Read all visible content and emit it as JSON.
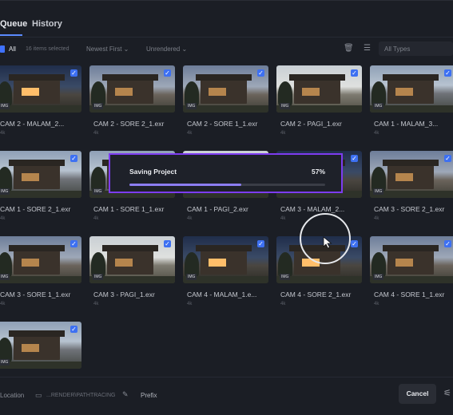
{
  "tabs": {
    "queue": "Queue",
    "history": "History"
  },
  "filter": {
    "all_label": "All",
    "selected_text": "16 items selected",
    "sort_label": "Newest First ⌄",
    "status_label": "Unrendered ⌄",
    "types_label": "All Types"
  },
  "items": [
    {
      "name": "CAM 2 - MALAM_2...",
      "sub": "4k",
      "badge": "IMG",
      "style": "night"
    },
    {
      "name": "CAM 2 - SORE 2_1.exr",
      "sub": "4k",
      "badge": "IMG",
      "style": "evening"
    },
    {
      "name": "CAM 2 - SORE 1_1.exr",
      "sub": "4k",
      "badge": "IMG",
      "style": "evening"
    },
    {
      "name": "CAM 2 - PAGI_1.exr",
      "sub": "4k",
      "badge": "IMG",
      "style": "dawn"
    },
    {
      "name": "CAM 1 - MALAM_3...",
      "sub": "4k",
      "badge": "IMG",
      "style": "day"
    },
    {
      "name": "CAM 1 - SORE 2_1.exr",
      "sub": "4k",
      "badge": "IMG",
      "style": "day"
    },
    {
      "name": "CAM 1 - SORE 1_1.exr",
      "sub": "4k",
      "badge": "IMG",
      "style": "day"
    },
    {
      "name": "CAM 1 - PAGI_2.exr",
      "sub": "4k",
      "badge": "IMG",
      "style": "dawn"
    },
    {
      "name": "CAM 3 - MALAM_2...",
      "sub": "4k",
      "badge": "IMG",
      "style": "night"
    },
    {
      "name": "CAM 3 - SORE 2_1.exr",
      "sub": "4k",
      "badge": "IMG",
      "style": "evening"
    },
    {
      "name": "CAM 3 - SORE 1_1.exr",
      "sub": "4k",
      "badge": "IMG",
      "style": "evening"
    },
    {
      "name": "CAM 3 - PAGI_1.exr",
      "sub": "4k",
      "badge": "IMG",
      "style": "dawn"
    },
    {
      "name": "CAM 4 - MALAM_1.e...",
      "sub": "4k",
      "badge": "IMG",
      "style": "night"
    },
    {
      "name": "CAM 4 - SORE 2_1.exr",
      "sub": "4k",
      "badge": "IMG",
      "style": "night"
    },
    {
      "name": "CAM 4 - SORE 1_1.exr",
      "sub": "4k",
      "badge": "IMG",
      "style": "evening"
    },
    {
      "name": "",
      "sub": "",
      "badge": "IMG",
      "style": "day"
    }
  ],
  "progress": {
    "title": "Saving Project",
    "percent_text": "57%",
    "percent": 57
  },
  "bottom": {
    "location_label": "Location",
    "path_text": "...RENDER\\PATHTRACING",
    "prefix_label": "Prefix",
    "cancel_label": "Cancel"
  },
  "colors": {
    "accent": "#3d70f2",
    "progress_border": "#7d3cf0",
    "progress_fill": "#8d7ef2"
  }
}
